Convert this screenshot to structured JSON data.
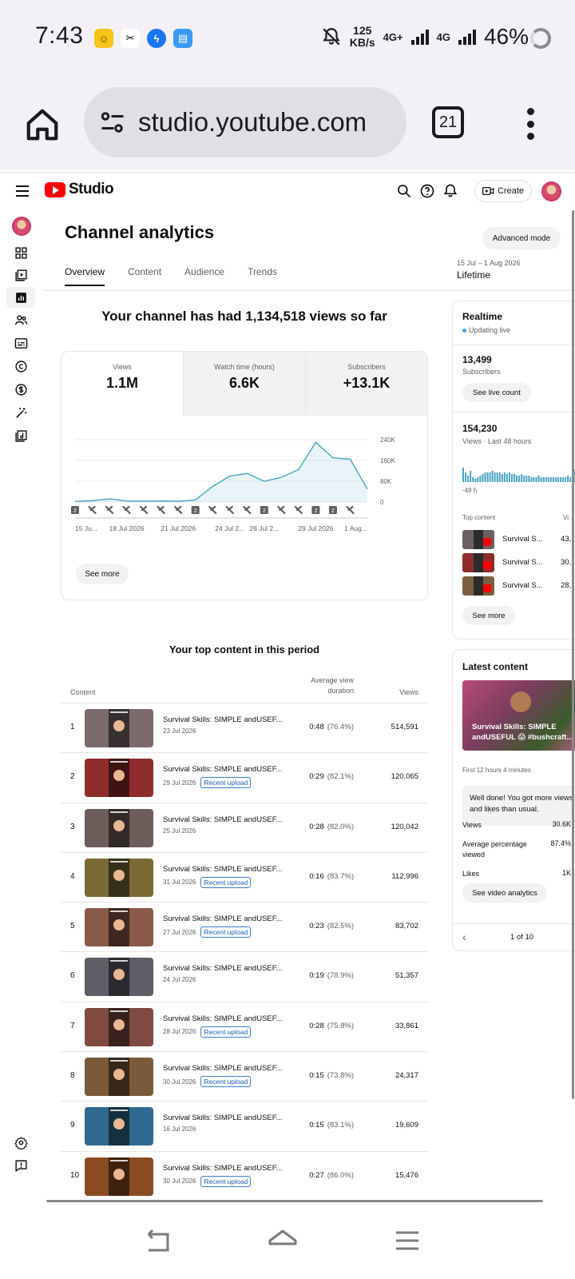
{
  "status_bar": {
    "time": "7:43",
    "net_speed_value": "125",
    "net_speed_unit": "KB/s",
    "net1": "4G+",
    "net2": "4G",
    "battery": "46%"
  },
  "browser": {
    "url": "studio.youtube.com",
    "tab_count": "21"
  },
  "header": {
    "logo_text": "Studio",
    "create_label": "Create"
  },
  "page": {
    "title": "Channel analytics",
    "advanced_mode": "Advanced mode",
    "date_range": "15 Jul – 1 Aug 2026",
    "date_label": "Lifetime",
    "tabs": [
      {
        "label": "Overview"
      },
      {
        "label": "Content"
      },
      {
        "label": "Audience"
      },
      {
        "label": "Trends"
      }
    ]
  },
  "overview": {
    "headline": "Your channel has had 1,134,518 views so far",
    "metrics": [
      {
        "label": "Views",
        "value": "1.1M"
      },
      {
        "label": "Watch time (hours)",
        "value": "6.6K"
      },
      {
        "label": "Subscribers",
        "value": "+13.1K"
      }
    ],
    "see_more": "See more"
  },
  "chart_data": {
    "type": "area",
    "x": [
      "15 Jul",
      "16 Jul",
      "17 Jul",
      "18 Jul",
      "19 Jul",
      "20 Jul",
      "21 Jul",
      "22 Jul",
      "23 Jul",
      "24 Jul",
      "25 Jul",
      "26 Jul",
      "27 Jul",
      "28 Jul",
      "29 Jul",
      "30 Jul",
      "31 Jul",
      "1 Aug"
    ],
    "y": [
      2000,
      5000,
      12000,
      4000,
      3000,
      4000,
      3000,
      8000,
      60000,
      100000,
      110000,
      80000,
      95000,
      125000,
      230000,
      170000,
      165000,
      50000
    ],
    "x_tick_labels": [
      "15 Ju...",
      "18 Jul 2026",
      "21 Jul 2026",
      "24 Jul 2...",
      "26 Jul 2...",
      "29 Jul 2026",
      "1 Aug..."
    ],
    "y_tick_labels": [
      "240K",
      "160K",
      "80K",
      "0"
    ],
    "ylim": [
      0,
      240000
    ],
    "grid": true,
    "color": "#4aa3c2",
    "marker_labels": [
      "2",
      "2",
      "2",
      "2",
      "2"
    ]
  },
  "top_content": {
    "title": "Your top content in this period",
    "columns": {
      "content": "Content",
      "avd_line1": "Average view",
      "avd_line2": "duration",
      "views": "Views"
    },
    "rows": [
      {
        "rank": "1",
        "title": "Survival Skills: SIMPLE andUSEF...",
        "date": "23 Jul 2026",
        "badge": "",
        "duration": "0:48",
        "pct": "(76.4%)",
        "views": "514,591",
        "thumb_color": "#7d6a6a"
      },
      {
        "rank": "2",
        "title": "Survival Skills: SIMPLE andUSEF...",
        "date": "29 Jul 2026",
        "badge": "Recent upload",
        "duration": "0:29",
        "pct": "(82.1%)",
        "views": "120,065",
        "thumb_color": "#8e2c2c"
      },
      {
        "rank": "3",
        "title": "Survival Skills: SIMPLE andUSEF...",
        "date": "25 Jul 2026",
        "badge": "",
        "duration": "0:28",
        "pct": "(82.0%)",
        "views": "120,042",
        "thumb_color": "#6d5e5b"
      },
      {
        "rank": "4",
        "title": "Survival Skills: SIMPLE andUSEF...",
        "date": "31 Jul 2026",
        "badge": "Recent upload",
        "duration": "0:16",
        "pct": "(83.7%)",
        "views": "112,996",
        "thumb_color": "#7a6a35"
      },
      {
        "rank": "5",
        "title": "Survival Skills: SIMPLE andUSEF...",
        "date": "27 Jul 2026",
        "badge": "Recent upload",
        "duration": "0:23",
        "pct": "(82.5%)",
        "views": "83,702",
        "thumb_color": "#8a5a4a"
      },
      {
        "rank": "6",
        "title": "Survival Skills: SIMPLE andUSEF...",
        "date": "24 Jul 2026",
        "badge": "",
        "duration": "0:19",
        "pct": "(78.9%)",
        "views": "51,357",
        "thumb_color": "#5e5e66"
      },
      {
        "rank": "7",
        "title": "Survival Skills: SIMPLE andUSEF...",
        "date": "28 Jul 2026",
        "badge": "Recent upload",
        "duration": "0:28",
        "pct": "(75.8%)",
        "views": "33,861",
        "thumb_color": "#7f4a42"
      },
      {
        "rank": "8",
        "title": "Survival Skills: SIMPLE andUSEF...",
        "date": "30 Jul 2026",
        "badge": "Recent upload",
        "duration": "0:15",
        "pct": "(73.8%)",
        "views": "24,317",
        "thumb_color": "#7a5a3a"
      },
      {
        "rank": "9",
        "title": "Survival Skills: SIMPLE andUSEF...",
        "date": "16 Jul 2026",
        "badge": "",
        "duration": "0:15",
        "pct": "(83.1%)",
        "views": "19,609",
        "thumb_color": "#2f6a8e"
      },
      {
        "rank": "10",
        "title": "Survival Skills: SIMPLE andUSEF...",
        "date": "30 Jul 2026",
        "badge": "Recent upload",
        "duration": "0:27",
        "pct": "(86.0%)",
        "views": "15,476",
        "thumb_color": "#8a4a22"
      }
    ]
  },
  "realtime": {
    "title": "Realtime",
    "status": "Updating live",
    "subscribers": "13,499",
    "subscribers_label": "Subscribers",
    "see_live_count": "See live count",
    "views": "154,230",
    "views_label": "Views · Last 48 hours",
    "axis_start": "-48 h",
    "top_content_label": "Top content",
    "views_col": "Vi",
    "items": [
      {
        "title": "Survival S...",
        "views": "43,"
      },
      {
        "title": "Survival S...",
        "views": "30,"
      },
      {
        "title": "Survival S...",
        "views": "28,"
      }
    ],
    "see_more": "See more"
  },
  "latest_content": {
    "title": "Latest content",
    "video_title_line1": "Survival Skills: SIMPLE",
    "video_title_line2": "andUSEFUL 😱 #bushcraft...",
    "first_hours": "First 12 hours 4 minutes",
    "note": "Well done! You got more views and likes than usual.",
    "stats": [
      {
        "label": "Views",
        "value": "30.6K"
      },
      {
        "label": "Average percentage viewed",
        "value": "87.4%"
      },
      {
        "label": "Likes",
        "value": "1K"
      }
    ],
    "analytics_button": "See video analytics",
    "pager": "1 of 10"
  }
}
